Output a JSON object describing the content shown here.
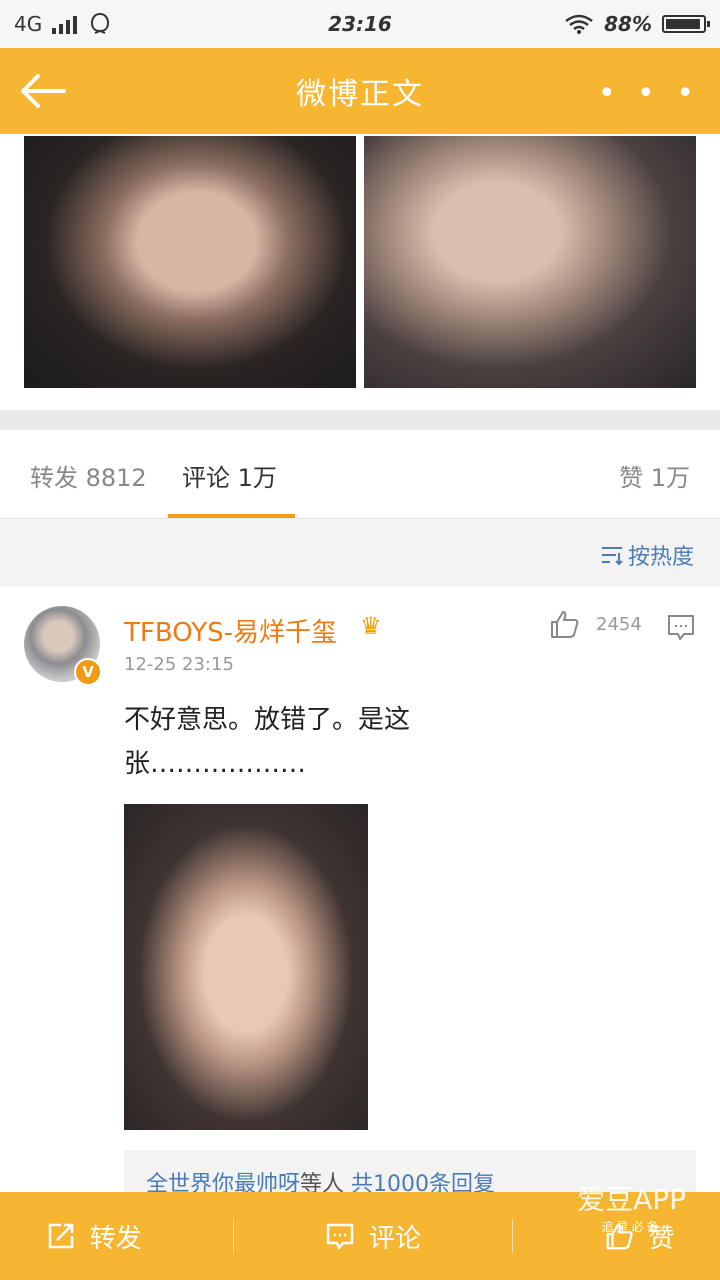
{
  "status_bar": {
    "network": "4G",
    "time": "23:16",
    "battery": "88%"
  },
  "nav": {
    "title": "微博正文",
    "more": "• • •"
  },
  "tabs": {
    "forward": "转发 8812",
    "comment": "评论 1万",
    "like": "赞 1万"
  },
  "sort": {
    "label": "按热度"
  },
  "comment": {
    "username": "TFBOYS-易烊千玺",
    "badge": "V",
    "time": "12-25 23:15",
    "like_count": "2454",
    "text": "不好意思。放错了。是这张………………",
    "replies": {
      "names": "全世界你最帅呀",
      "suffix": "等人",
      "count": "共1000条回复"
    }
  },
  "bottom_bar": {
    "forward": "转发",
    "comment": "评论",
    "like": "赞"
  },
  "watermark": {
    "brand": "爱豆APP",
    "sub": "追星必备"
  },
  "colors": {
    "brand_orange": "#f6b631",
    "accent": "#f39c1f",
    "link": "#4a7cb6",
    "username": "#f07a12"
  }
}
